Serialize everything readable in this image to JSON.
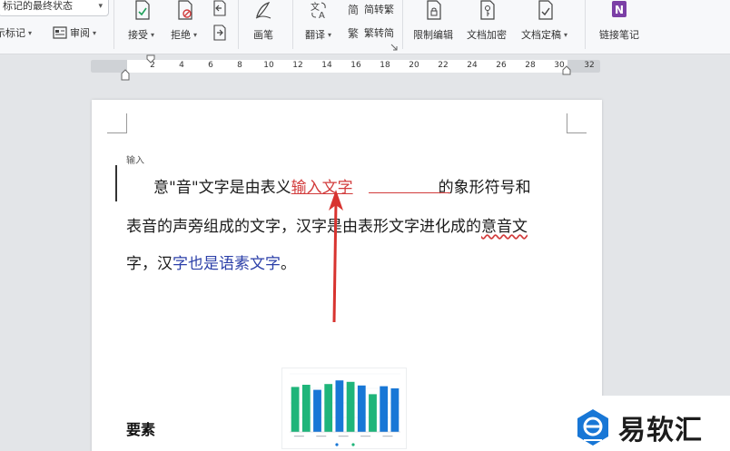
{
  "ribbon": {
    "status_select": "标记的最终状态",
    "show_markup": "显示标记",
    "review_pane": "审阅",
    "accept": "接受",
    "reject": "拒绝",
    "pen": "画笔",
    "translate": "翻译",
    "to_traditional": "简转繁",
    "to_simplified": "繁转简",
    "restrict_edit": "限制编辑",
    "encrypt_doc": "文档加密",
    "finalize_doc": "文档定稿",
    "link_notes": "链接笔记"
  },
  "ruler": {
    "ticks": [
      "2",
      "4",
      "6",
      "8",
      "10",
      "12",
      "14",
      "16",
      "18",
      "20",
      "22",
      "24",
      "26",
      "28",
      "30",
      "32"
    ]
  },
  "document": {
    "revision_tag": "输入",
    "line1_before": "意\"音\"文字是由表义",
    "line1_inserted": "输入文字",
    "line1_after": "的象形符号和",
    "line2_a": "表音的声旁组成的文字，汉字是由表形文字进化成的",
    "line2_b": "意音文",
    "line3_a": "字，汉",
    "line3_b": "字也是语素文字",
    "line3_c": "。",
    "heading": "要素"
  },
  "chart_data": {
    "type": "bar",
    "categories": [
      "",
      "",
      "",
      "",
      "",
      "",
      "",
      "",
      "",
      ""
    ],
    "values": [
      62,
      65,
      58,
      66,
      71,
      69,
      64,
      52,
      63,
      60
    ],
    "colors": [
      "#1fb57a",
      "#1fb57a",
      "#1877d6",
      "#1fb57a",
      "#1877d6",
      "#1fb57a",
      "#1877d6",
      "#1fb57a",
      "#1877d6",
      "#1877d6"
    ],
    "ylim": [
      0,
      80
    ],
    "grid": true
  },
  "watermark": {
    "text": "易软汇"
  },
  "colors": {
    "accent_red": "#d23c3c",
    "revision_blue": "#2b3fa8"
  }
}
